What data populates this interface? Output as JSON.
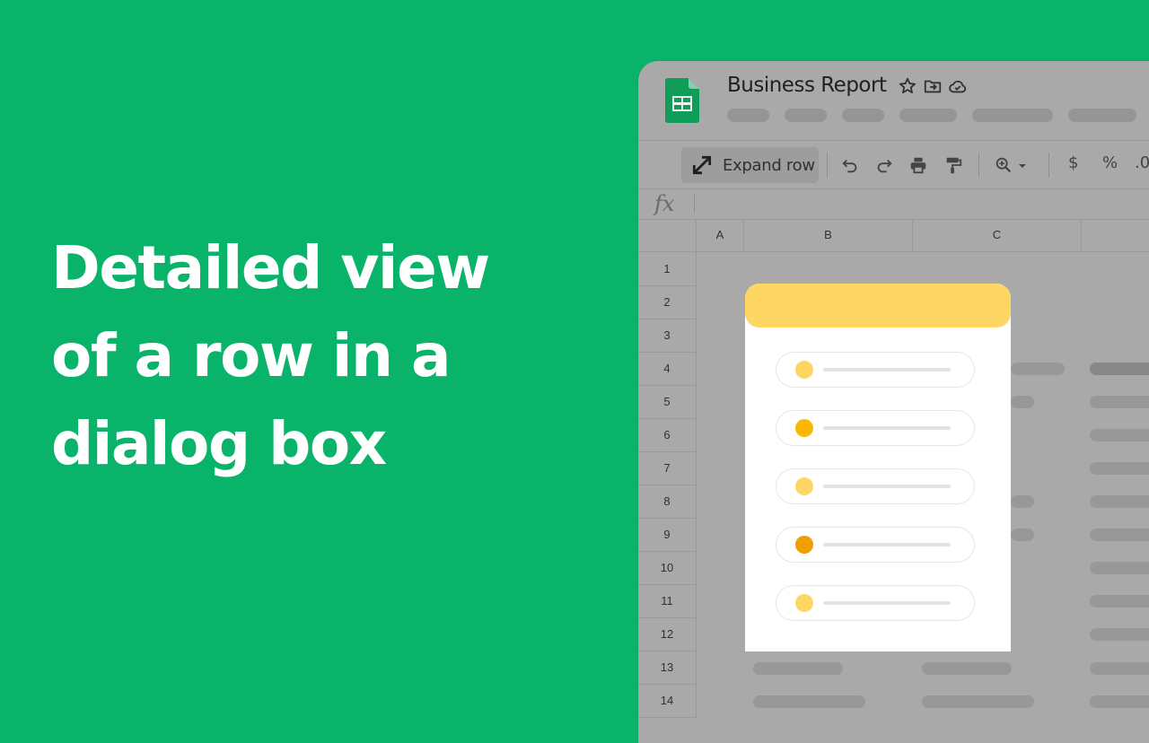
{
  "headline": {
    "line1": "Detailed view",
    "line2": "of a row in a",
    "line3": "dialog box"
  },
  "colors": {
    "background": "#0ab36a",
    "sheets_green": "#0f9d58",
    "dialog_header": "#fdd663",
    "dot_colors": [
      "#fdd663",
      "#f9b805",
      "#fdd663",
      "#f09d00",
      "#fdd663"
    ]
  },
  "spreadsheet": {
    "title": "Business Report",
    "title_icons": [
      "star-icon",
      "move-to-folder-icon",
      "cloud-saved-icon"
    ],
    "toolbar": {
      "expand_row_label": "Expand row",
      "icons": [
        "undo-icon",
        "redo-icon",
        "print-icon",
        "paint-format-icon",
        "zoom-icon"
      ],
      "currency_label": "$",
      "percent_label": "%",
      "decimal_label": ".0"
    },
    "formula_label": "fx",
    "columns": [
      "A",
      "B",
      "C"
    ],
    "rows": [
      "1",
      "2",
      "3",
      "4",
      "5",
      "6",
      "7",
      "8",
      "9",
      "10",
      "11",
      "12",
      "13",
      "14"
    ]
  },
  "dialog": {
    "field_count": 5,
    "icon": "row-detail-dialog"
  }
}
